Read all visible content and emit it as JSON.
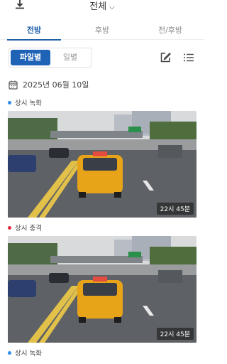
{
  "header": {
    "filter_label": "전체"
  },
  "tabs": [
    {
      "label": "전방",
      "active": true
    },
    {
      "label": "후방",
      "active": false
    },
    {
      "label": "전/후방",
      "active": false
    }
  ],
  "view_toggle": {
    "by_file": "파일별",
    "by_day": "일별"
  },
  "date_header": "2025년 06월 10일",
  "recordings": [
    {
      "type_label": "상시 녹화",
      "dot_color": "#2e8ef0",
      "time": "22시 45분"
    },
    {
      "type_label": "상시 충격",
      "dot_color": "#e0283a",
      "time": "22시 45분"
    },
    {
      "type_label": "상시 녹화",
      "dot_color": "#2e8ef0",
      "time": ""
    }
  ],
  "colors": {
    "accent": "#1f63b6",
    "tab_active": "#1b5fa8"
  }
}
